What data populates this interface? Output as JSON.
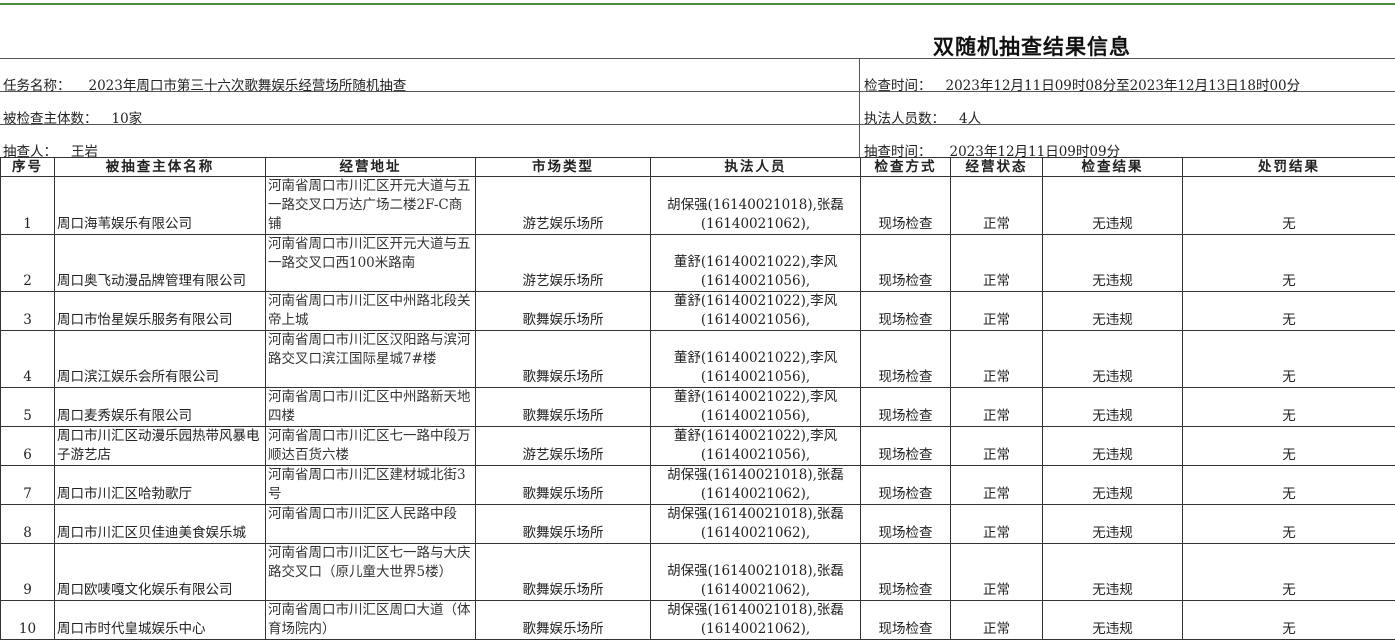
{
  "title": "双随机抽查结果信息",
  "meta": {
    "task_label": "任务名称：",
    "task_value": "2023年周口市第三十六次歌舞娱乐经营场所随机抽查",
    "check_time_label": "检查时间：",
    "check_time_value": "2023年12月11日09时08分至2023年12月13日18时00分",
    "subjects_label": "被检查主体数：",
    "subjects_value": "10家",
    "officers_label": "执法人员数：",
    "officers_value": "4人",
    "inspector_label": "抽查人：",
    "inspector_value": "王岩",
    "check_time2_label": "抽查时间：",
    "check_time2_value": "2023年12月11日09时09分"
  },
  "columns": [
    "序号",
    "被抽查主体名称",
    "经营地址",
    "市场类型",
    "执法人员",
    "检查方式",
    "经营状态",
    "检查结果",
    "处罚结果"
  ],
  "rows": [
    {
      "no": "1",
      "name": "周口海苇娱乐有限公司",
      "addr": "河南省周口市川汇区开元大道与五一路交叉口万达广场二楼2F-C商铺",
      "type": "游艺娱乐场所",
      "officers": "胡保强(16140021018),张磊(16140021062),",
      "method": "现场检查",
      "status": "正常",
      "result": "无违规",
      "penalty": "无"
    },
    {
      "no": "2",
      "name": "周口奥飞动漫品牌管理有限公司",
      "addr": "河南省周口市川汇区开元大道与五一路交叉口西100米路南",
      "type": "游艺娱乐场所",
      "officers": "董舒(16140021022),李风(16140021056),",
      "method": "现场检查",
      "status": "正常",
      "result": "无违规",
      "penalty": "无"
    },
    {
      "no": "3",
      "name": "周口市怡星娱乐服务有限公司",
      "addr": "河南省周口市川汇区中州路北段关帝上城",
      "type": "歌舞娱乐场所",
      "officers": "董舒(16140021022),李风(16140021056),",
      "method": "现场检查",
      "status": "正常",
      "result": "无违规",
      "penalty": "无"
    },
    {
      "no": "4",
      "name": "周口滨江娱乐会所有限公司",
      "addr": "河南省周口市川汇区汉阳路与滨河路交叉口滨江国际星城7#楼",
      "type": "歌舞娱乐场所",
      "officers": "董舒(16140021022),李风(16140021056),",
      "method": "现场检查",
      "status": "正常",
      "result": "无违规",
      "penalty": "无"
    },
    {
      "no": "5",
      "name": "周口麦秀娱乐有限公司",
      "addr": "河南省周口市川汇区中州路新天地四楼",
      "type": "歌舞娱乐场所",
      "officers": "董舒(16140021022),李风(16140021056),",
      "method": "现场检查",
      "status": "正常",
      "result": "无违规",
      "penalty": "无"
    },
    {
      "no": "6",
      "name": "周口市川汇区动漫乐园热带风暴电子游艺店",
      "addr": "河南省周口市川汇区七一路中段万顺达百货六楼",
      "type": "游艺娱乐场所",
      "officers": "董舒(16140021022),李风(16140021056),",
      "method": "现场检查",
      "status": "正常",
      "result": "无违规",
      "penalty": "无"
    },
    {
      "no": "7",
      "name": "周口市川汇区哈勃歌厅",
      "addr": "河南省周口市川汇区建材城北街3号",
      "type": "歌舞娱乐场所",
      "officers": "胡保强(16140021018),张磊(16140021062),",
      "method": "现场检查",
      "status": "正常",
      "result": "无违规",
      "penalty": "无"
    },
    {
      "no": "8",
      "name": "周口市川汇区贝佳迪美食娱乐城",
      "addr": "河南省周口市川汇区人民路中段",
      "type": "歌舞娱乐场所",
      "officers": "胡保强(16140021018),张磊(16140021062),",
      "method": "现场检查",
      "status": "正常",
      "result": "无违规",
      "penalty": "无"
    },
    {
      "no": "9",
      "name": "周口欧唛嘎文化娱乐有限公司",
      "addr": "河南省周口市川汇区七一路与大庆路交叉口（原儿童大世界5楼）",
      "type": "歌舞娱乐场所",
      "officers": "胡保强(16140021018),张磊(16140021062),",
      "method": "现场检查",
      "status": "正常",
      "result": "无违规",
      "penalty": "无"
    },
    {
      "no": "10",
      "name": "周口市时代皇城娱乐中心",
      "addr": "河南省周口市川汇区周口大道（体育场院内）",
      "type": "歌舞娱乐场所",
      "officers": "胡保强(16140021018),张磊(16140021062),",
      "method": "现场检查",
      "status": "正常",
      "result": "无违规",
      "penalty": "无"
    }
  ]
}
